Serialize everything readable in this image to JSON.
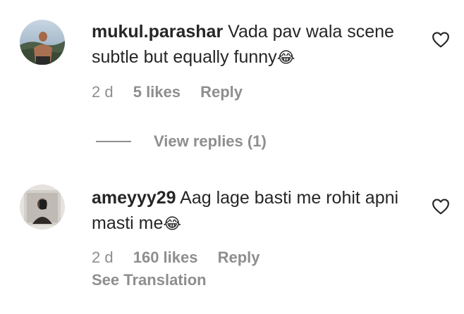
{
  "comments": [
    {
      "username": "mukul.parashar",
      "text": "Vada pav wala scene subtle but equally funny",
      "emoji": "😂",
      "time": "2 d",
      "likes": "5 likes",
      "reply": "Reply"
    },
    {
      "username": "ameyyy29",
      "text": "Aag lage basti me rohit apni masti me",
      "emoji": "😂",
      "time": "2 d",
      "likes": "160 likes",
      "reply": "Reply",
      "translation": "See Translation"
    }
  ],
  "view_replies": "View replies (1)",
  "colors": {
    "text": "#262626",
    "secondary": "#8e8e8e",
    "background": "#ffffff"
  },
  "icons": {
    "like": "heart-outline-icon"
  }
}
